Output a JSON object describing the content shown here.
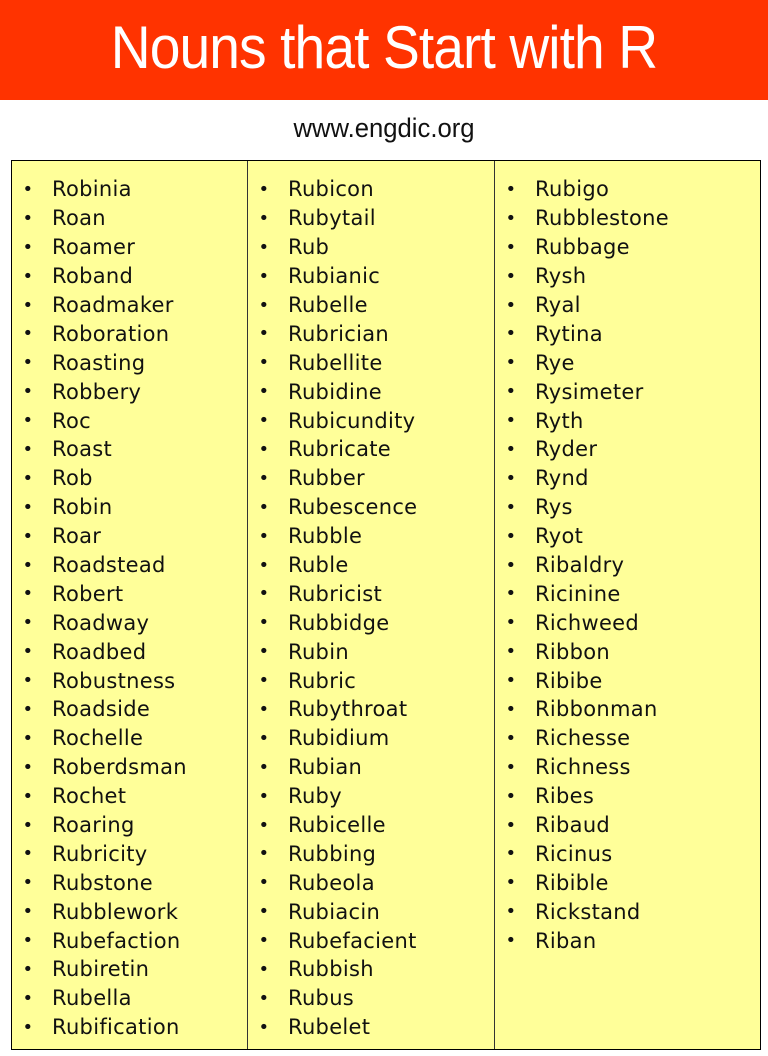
{
  "header": {
    "title": "Nouns that Start with R",
    "website": "www.engdic.org",
    "banner_color": "#ff3300",
    "table_background": "#ffff99"
  },
  "columns": [
    {
      "items": [
        "Robinia",
        "Roan",
        "Roamer",
        "Roband",
        "Roadmaker",
        "Roboration",
        "Roasting",
        "Robbery",
        "Roc",
        "Roast",
        "Rob",
        "Robin",
        "Roar",
        "Roadstead",
        "Robert",
        "Roadway",
        "Roadbed",
        "Robustness",
        "Roadside",
        "Rochelle",
        "Roberdsman",
        "Rochet",
        "Roaring",
        "Rubricity",
        "Rubstone",
        "Rubblework",
        "Rubefaction",
        "Rubiretin",
        "Rubella",
        "Rubification"
      ]
    },
    {
      "items": [
        "Rubicon",
        "Rubytail",
        "Rub",
        "Rubianic",
        "Rubelle",
        "Rubrician",
        "Rubellite",
        "Rubidine",
        "Rubicundity",
        "Rubricate",
        "Rubber",
        "Rubescence",
        "Rubble",
        "Ruble",
        "Rubricist",
        "Rubbidge",
        "Rubin",
        "Rubric",
        "Rubythroat",
        "Rubidium",
        "Rubian",
        "Ruby",
        "Rubicelle",
        "Rubbing",
        "Rubeola",
        "Rubiacin",
        "Rubefacient",
        "Rubbish",
        "Rubus",
        "Rubelet"
      ]
    },
    {
      "items": [
        "Rubigo",
        "Rubblestone",
        "Rubbage",
        "Rysh",
        "Ryal",
        "Rytina",
        "Rye",
        "Rysimeter",
        "Ryth",
        "Ryder",
        "Rynd",
        "Rys",
        "Ryot",
        "Ribaldry",
        "Ricinine",
        "Richweed",
        "Ribbon",
        "Ribibe",
        "Ribbonman",
        "Richesse",
        "Richness",
        "Ribes",
        "Ribaud",
        "Ricinus",
        "Ribible",
        "Rickstand",
        "Riban"
      ]
    }
  ],
  "bullet_glyph": "•"
}
